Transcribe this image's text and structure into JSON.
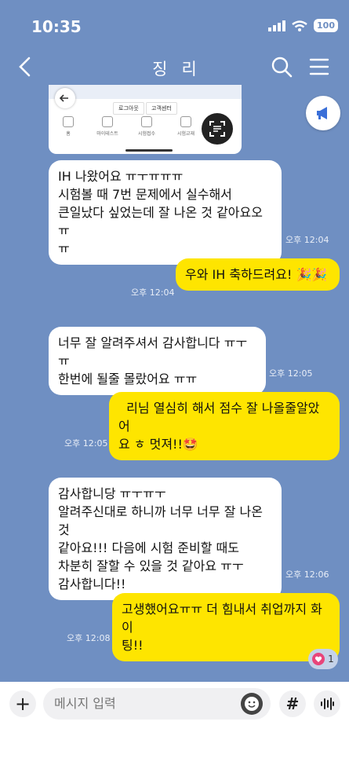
{
  "status": {
    "time": "10:35",
    "battery": "100"
  },
  "header": {
    "title": "징리"
  },
  "image_card": {
    "pills": [
      "로그아웃",
      "고객센터"
    ],
    "nav": [
      "홈",
      "마이테스트",
      "시험접수",
      "시험교재"
    ]
  },
  "messages": [
    {
      "side": "recv",
      "text": "IH 나왔어요 ㅠㅜㅠㅠㅠ\n시험볼 때 7번 문제에서 실수해서\n큰일났다 싶었는데 잘 나온 것 같아요오 ㅠ\nㅠ",
      "time": "오후 12:04"
    },
    {
      "side": "sent",
      "text": "우와 IH 축하드려요! 🎉🎉",
      "time": "오후 12:04"
    },
    {
      "side": "recv",
      "text": "너무 잘 알려주셔서 감사합니다 ㅠㅜㅠ\n한번에 될줄 몰랐어요 ㅠㅠ",
      "time": "오후 12:05"
    },
    {
      "side": "sent",
      "text": "  리님 열심히 해서 점수 잘 나올줄알았어\n요 ㅎ 멋져!!🤩",
      "time": "오후 12:05"
    },
    {
      "side": "recv",
      "text": "감사합니당 ㅠㅜㅠㅜ\n알려주신대로 하니까 너무 너무 잘 나온 것\n같아요!!! 다음에 시험 준비할 때도\n차분히 잘할 수 있을 것 같아요 ㅠㅜ\n감사합니다!!",
      "time": "오후 12:06"
    },
    {
      "side": "sent",
      "text": "고생했어요ㅠㅠ 더 힘내서 취업까지 화이\n팅!!",
      "time": "오후 12:08"
    }
  ],
  "reaction": {
    "icon": "heart-icon",
    "count": "1"
  },
  "input": {
    "placeholder": "메시지 입력",
    "hash_label": "#"
  },
  "colors": {
    "background": "#6f8fc2",
    "sent": "#fee500",
    "received": "#ffffff"
  }
}
